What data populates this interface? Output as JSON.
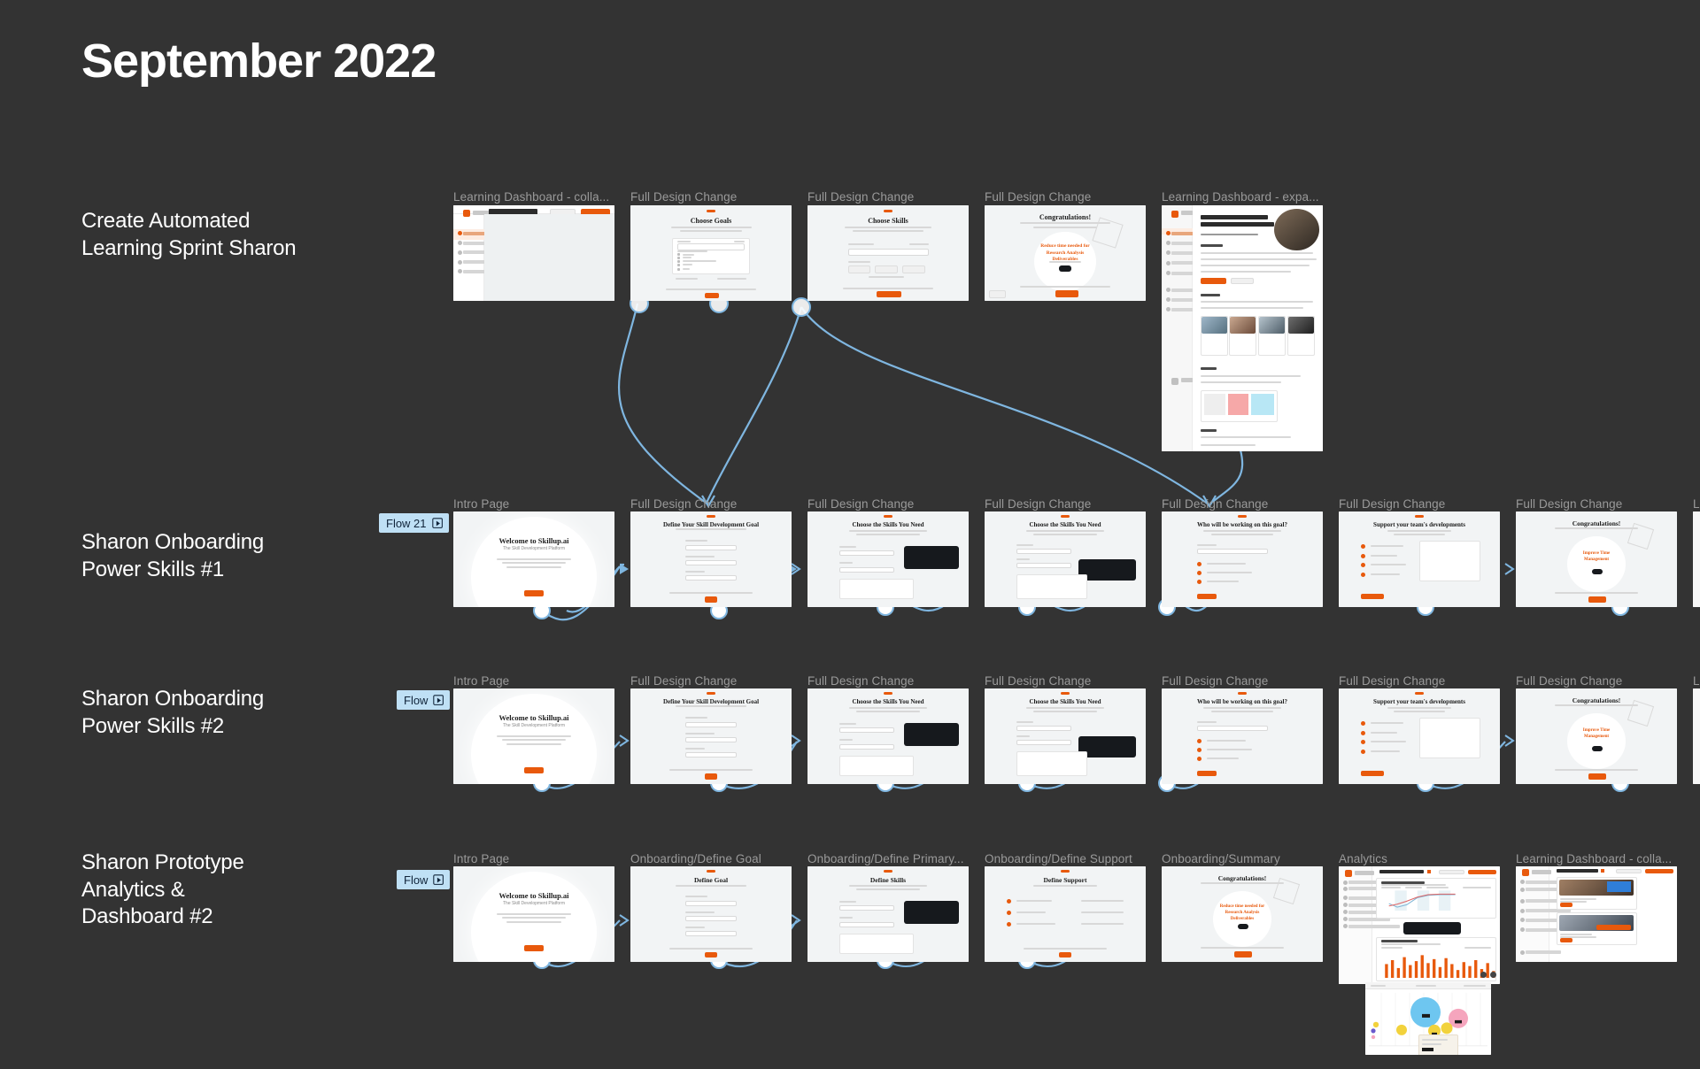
{
  "board": {
    "background_color": "#333333",
    "title": "September 2022",
    "frame_title_color": "#9a9a9a",
    "accent_color": "#e8590c",
    "connector_color": "#7fb6e0",
    "flow_badge_color": "#bfe0f5"
  },
  "rows": [
    {
      "label": "Create Automated\nLearning Sprint Sharon",
      "label_line1": "Create Automated",
      "label_line2": "Learning Sprint Sharon",
      "flow_badge": null,
      "frames": [
        {
          "title": "Learning Dashboard - colla...",
          "mock": "dashboard-empty",
          "heading": "Learning Dashboard"
        },
        {
          "title": "Full Design Change",
          "mock": "form-goals",
          "heading": "Choose Goals"
        },
        {
          "title": "Full Design Change",
          "mock": "form-skills",
          "heading": "Choose Skills"
        },
        {
          "title": "Full Design Change",
          "mock": "congrats",
          "heading": "Congratulations!",
          "badge_text": "Reduce time needed for Research Analysis Deliverables"
        },
        {
          "title": "Learning Dashboard - expa...",
          "mock": "dashboard-long",
          "heading": "Reduce time needed for Research Analysis Deliverables"
        }
      ]
    },
    {
      "label_line1": "Sharon Onboarding",
      "label_line2": "Power Skills #1",
      "flow_badge": "Flow 21",
      "frames": [
        {
          "title": "Intro Page",
          "mock": "intro",
          "heading": "Welcome to Skillup.ai",
          "subheading": "The Skill Development Platform"
        },
        {
          "title": "Full Design Change",
          "mock": "define-goal",
          "heading": "Define Your Skill Development Goal"
        },
        {
          "title": "Full Design Change",
          "mock": "choose-skills-dark",
          "heading": "Choose the Skills You Need"
        },
        {
          "title": "Full Design Change",
          "mock": "choose-skills-dark2",
          "heading": "Choose the Skills You Need"
        },
        {
          "title": "Full Design Change",
          "mock": "who-working",
          "heading": "Who will be working on this goal?"
        },
        {
          "title": "Full Design Change",
          "mock": "support-team",
          "heading": "Support your team's developments"
        },
        {
          "title": "Full Design Change",
          "mock": "congrats",
          "heading": "Congratulations!",
          "badge_text": "Improve Time Management"
        },
        {
          "title": "Lea",
          "mock": "partial",
          "heading": ""
        }
      ]
    },
    {
      "label_line1": "Sharon Onboarding",
      "label_line2": "Power Skills #2",
      "flow_badge": "Flow",
      "frames": [
        {
          "title": "Intro Page",
          "mock": "intro",
          "heading": "Welcome to Skillup.ai",
          "subheading": "The Skill Development Platform"
        },
        {
          "title": "Full Design Change",
          "mock": "define-goal",
          "heading": "Define Your Skill Development Goal"
        },
        {
          "title": "Full Design Change",
          "mock": "choose-skills-dark",
          "heading": "Choose the Skills You Need"
        },
        {
          "title": "Full Design Change",
          "mock": "choose-skills-dark2",
          "heading": "Choose the Skills You Need"
        },
        {
          "title": "Full Design Change",
          "mock": "who-working",
          "heading": "Who will be working on this goal?"
        },
        {
          "title": "Full Design Change",
          "mock": "support-team",
          "heading": "Support your team's developments"
        },
        {
          "title": "Full Design Change",
          "mock": "congrats",
          "heading": "Congratulations!",
          "badge_text": "Improve Time Management"
        },
        {
          "title": "Lea",
          "mock": "partial",
          "heading": ""
        }
      ]
    },
    {
      "label_line1": "Sharon Prototype",
      "label_line2": "Analytics &",
      "label_line3": "Dashboard #2",
      "flow_badge": "Flow",
      "frames": [
        {
          "title": "Intro Page",
          "mock": "intro",
          "heading": "Welcome to Skillup.ai",
          "subheading": "The Skill Development Platform"
        },
        {
          "title": "Onboarding/Define Goal",
          "mock": "define-goal-2",
          "heading": "Define Goal"
        },
        {
          "title": "Onboarding/Define Primary...",
          "mock": "define-skills",
          "heading": "Define Skills"
        },
        {
          "title": "Onboarding/Define Support",
          "mock": "define-support",
          "heading": "Define Support"
        },
        {
          "title": "Onboarding/Summary",
          "mock": "congrats",
          "heading": "Congratulations!",
          "badge_text": "Reduce time needed for Research Analysis Deliverables"
        },
        {
          "title": "Analytics",
          "mock": "analytics",
          "heading": "Create learning sprint"
        },
        {
          "title": "Learning Dashboard - colla...",
          "mock": "learning-dash-cards",
          "heading": "Create learning sprint"
        }
      ]
    }
  ],
  "detached_frame": {
    "title": "",
    "mock": "bubble-chart",
    "labels": [
      "Time Management",
      "Negotiation",
      "Creativity",
      "Leadership"
    ]
  }
}
